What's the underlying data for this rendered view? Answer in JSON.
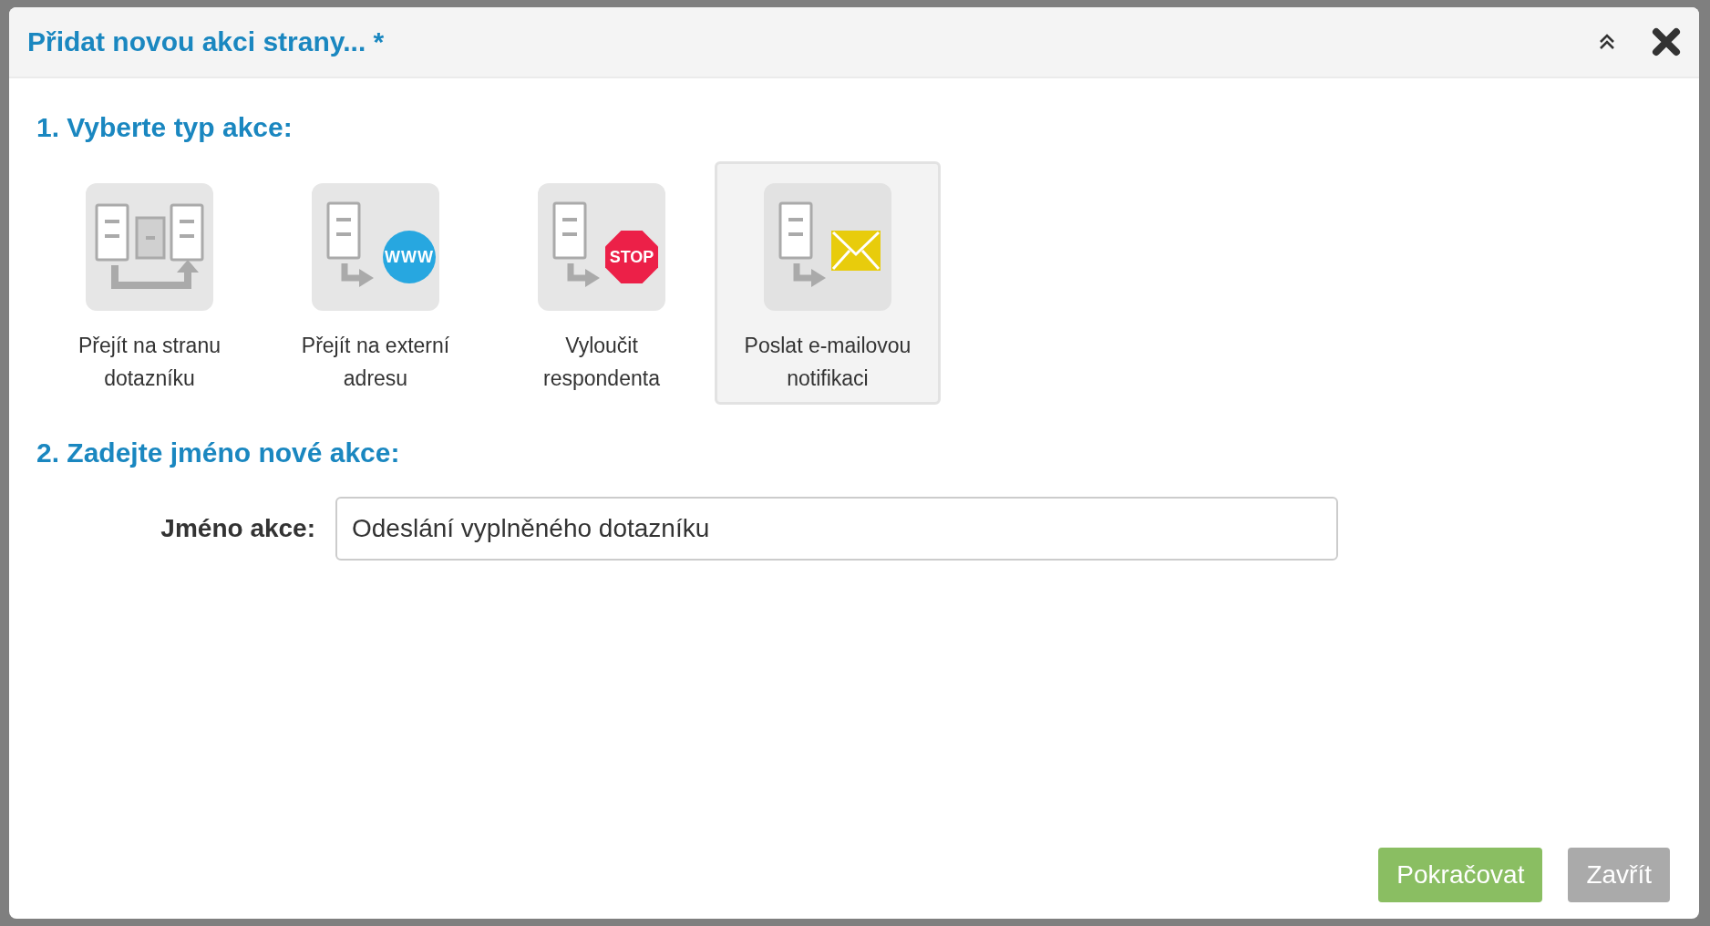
{
  "dialog": {
    "title": "Přidat novou akci strany... *"
  },
  "step_1": {
    "heading": "1. Vyberte typ akce:",
    "action_types": [
      {
        "kind": "page",
        "label": "Přejít na stranu dotazníku",
        "selected": false
      },
      {
        "kind": "url",
        "label": "Přejít na externí adresu",
        "badge": "WWW",
        "selected": false
      },
      {
        "kind": "stop",
        "label": "Vyloučit respondenta",
        "badge": "STOP",
        "selected": false
      },
      {
        "kind": "email",
        "label": "Poslat e-mailovou notifikaci",
        "selected": true
      }
    ]
  },
  "step_2": {
    "heading": "2. Zadejte jméno nové akce:",
    "field_label": "Jméno akce:",
    "value": "Odeslání vyplněného dotazníku"
  },
  "buttons": [
    {
      "kind": "primary",
      "label": "Pokračovat"
    },
    {
      "kind": "secondary",
      "label": "Zavřít"
    }
  ]
}
